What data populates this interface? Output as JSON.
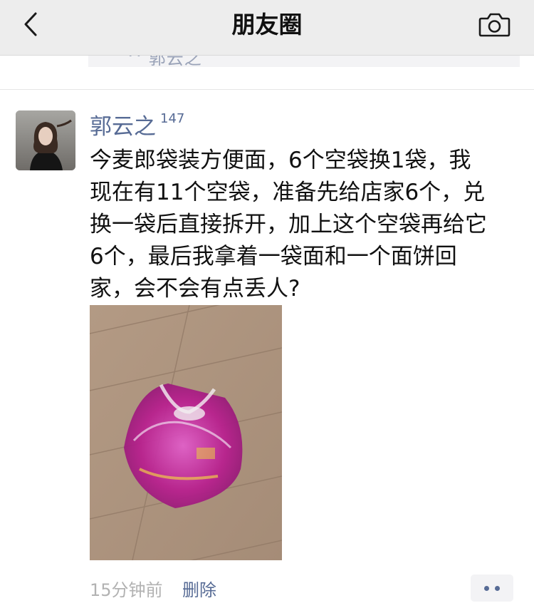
{
  "header": {
    "title": "朋友圈",
    "back_icon": "chevron-left-icon",
    "camera_icon": "camera-icon"
  },
  "previous_post": {
    "text": "^ 郭云之"
  },
  "post": {
    "author_name": "郭云之",
    "author_badge": "147",
    "content_lines": [
      "今麦郎袋装方便面，6个空袋换1袋，我",
      "现在有11个空袋，准备先给店家6个，兑",
      "换一袋后直接拆开，加上这个空袋再给它",
      "6个，最后我拿着一袋面和一个面饼回",
      "家，会不会有点丢人?"
    ],
    "timestamp": "15分钟前",
    "delete_label": "删除",
    "more_icon": "more-dots-icon"
  },
  "colors": {
    "link": "#576b95",
    "header_bg": "#ededed",
    "meta_gray": "#b2b2b2"
  }
}
